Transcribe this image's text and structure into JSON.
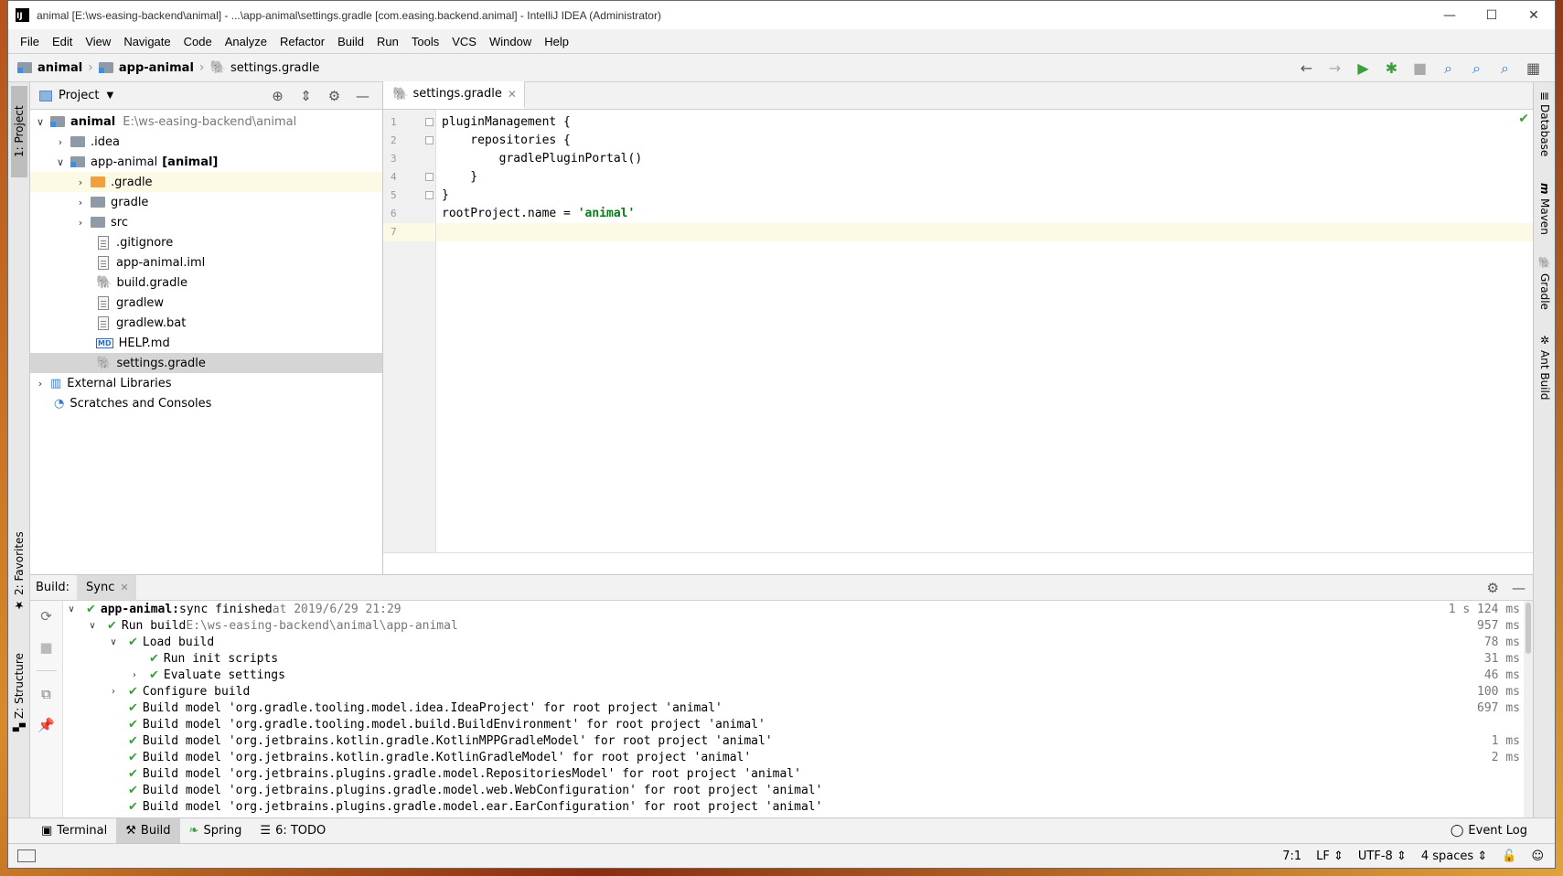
{
  "titlebar": {
    "title": "animal [E:\\ws-easing-backend\\animal] - ...\\app-animal\\settings.gradle [com.easing.backend.animal] - IntelliJ IDEA (Administrator)",
    "logo": "IJ",
    "minimize": "—",
    "maximize": "☐",
    "close": "✕"
  },
  "menu": {
    "file": "File",
    "edit": "Edit",
    "view": "View",
    "navigate": "Navigate",
    "code": "Code",
    "analyze": "Analyze",
    "refactor": "Refactor",
    "build": "Build",
    "run": "Run",
    "tools": "Tools",
    "vcs": "VCS",
    "window": "Window",
    "help": "Help"
  },
  "breadcrumb": {
    "root": "animal",
    "module": "app-animal",
    "file": "settings.gradle"
  },
  "left_strip": {
    "project_tab": "1: Project",
    "favorites_tab": "2: Favorites",
    "structure_tab": "Z: Structure"
  },
  "right_strip": {
    "database": "Database",
    "maven": "Maven",
    "gradle": "Gradle",
    "ant": "Ant Build"
  },
  "project_panel": {
    "title": "Project",
    "tree": {
      "root_name": "animal",
      "root_path": "E:\\ws-easing-backend\\animal",
      "idea": ".idea",
      "module_name": "app-animal",
      "module_tag": "[animal]",
      "dot_gradle": ".gradle",
      "gradle": "gradle",
      "src": "src",
      "gitignore": ".gitignore",
      "iml": "app-animal.iml",
      "build_gradle": "build.gradle",
      "gradlew": "gradlew",
      "gradlew_bat": "gradlew.bat",
      "help_md": "HELP.md",
      "settings_gradle": "settings.gradle",
      "external_libraries": "External Libraries",
      "scratches": "Scratches and Consoles"
    }
  },
  "editor": {
    "tab_label": "settings.gradle",
    "line_numbers": [
      "1",
      "2",
      "3",
      "4",
      "5",
      "6",
      "7"
    ],
    "lines": {
      "l1": "pluginManagement {",
      "l2": "    repositories {",
      "l3": "        gradlePluginPortal()",
      "l4": "    }",
      "l5": "}",
      "l6_code": "rootProject.name = ",
      "l6_string": "'animal'",
      "l7": ""
    }
  },
  "build_panel": {
    "label": "Build:",
    "tab": "Sync",
    "rows": {
      "r0_name": "app-animal:",
      "r0_text": " sync finished",
      "r0_at": " at 2019/6/29 21:29",
      "r0_time": "1 s 124 ms",
      "r1_text": "Run build ",
      "r1_path": "E:\\ws-easing-backend\\animal\\app-animal",
      "r1_time": "957 ms",
      "r2_text": "Load build",
      "r2_time": "78 ms",
      "r3_text": "Run init scripts",
      "r3_time": "31 ms",
      "r4_text": "Evaluate settings",
      "r4_time": "46 ms",
      "r5_text": "Configure build",
      "r5_time": "100 ms",
      "r6_text": "Build model 'org.gradle.tooling.model.idea.IdeaProject' for root project 'animal'",
      "r6_time": "697 ms",
      "r7_text": "Build model 'org.gradle.tooling.model.build.BuildEnvironment' for root project 'animal'",
      "r8_text": "Build model 'org.jetbrains.kotlin.gradle.KotlinMPPGradleModel' for root project 'animal'",
      "r8_time": "1 ms",
      "r9_text": "Build model 'org.jetbrains.kotlin.gradle.KotlinGradleModel' for root project 'animal'",
      "r9_time": "2 ms",
      "r10_text": "Build model 'org.jetbrains.plugins.gradle.model.RepositoriesModel' for root project 'animal'",
      "r11_text": "Build model 'org.jetbrains.plugins.gradle.model.web.WebConfiguration' for root project 'animal'",
      "r12_text": "Build model 'org.jetbrains.plugins.gradle.model.ear.EarConfiguration' for root project 'animal'"
    }
  },
  "bottom_tabs": {
    "terminal": "Terminal",
    "build": "Build",
    "spring": "Spring",
    "todo": "6: TODO",
    "event_log": "Event Log"
  },
  "status": {
    "position": "7:1",
    "line_sep": "LF",
    "encoding": "UTF-8",
    "indent": "4 spaces"
  }
}
